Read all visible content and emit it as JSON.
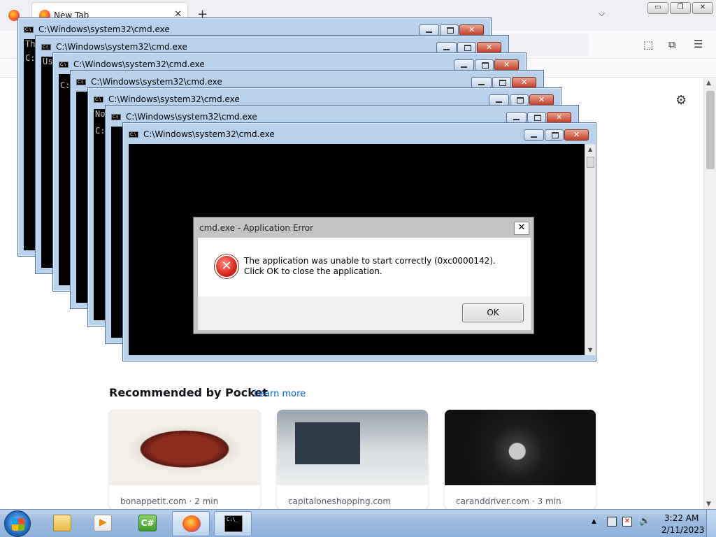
{
  "browser": {
    "tab_title": "New Tab",
    "tab_close": "✕",
    "new_tab": "+",
    "tab_list": "⌵",
    "window_buttons": [
      "▭",
      "❐",
      "✕"
    ],
    "toolbar_icons": [
      "⬚",
      "⧉",
      "☰"
    ],
    "settings_icon": "⚙"
  },
  "cmd_windows": {
    "title": "C:\\Windows\\system32\\cmd.exe",
    "icon_text": "C:\\",
    "console_fragments": [
      "Th",
      "C:",
      "Us",
      "C:",
      "No",
      "C:"
    ]
  },
  "dialog": {
    "title": "cmd.exe - Application Error",
    "close": "✕",
    "message": "The application was unable to start correctly (0xc0000142). Click OK to close the application.",
    "ok_label": "OK",
    "icon_glyph": "✕"
  },
  "pocket": {
    "heading": "Recommended by Pocket",
    "learn_more": "Learn more",
    "cards": [
      {
        "source": "bonappetit.com · 2 min"
      },
      {
        "source": "capitaloneshopping.com"
      },
      {
        "source": "caranddriver.com · 3 min"
      }
    ]
  },
  "taskbar": {
    "cs_label": "C#",
    "cmd_label": "C:\\_",
    "time": "3:22 AM",
    "date": "2/11/2023",
    "tray_arrow": "▲",
    "volume_icon": "🔊"
  }
}
